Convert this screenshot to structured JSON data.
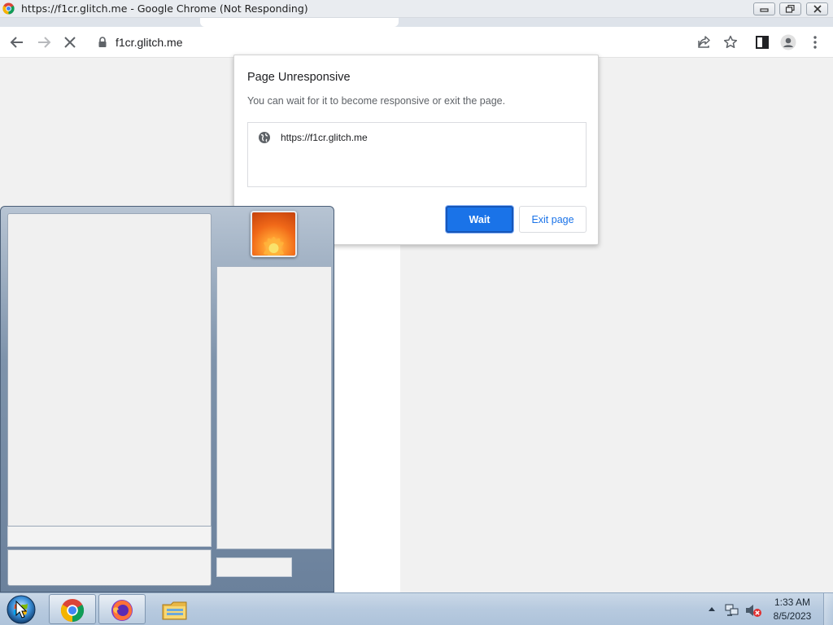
{
  "window": {
    "title": "https://f1cr.glitch.me - Google Chrome (Not Responding)"
  },
  "toolbar": {
    "url": "f1cr.glitch.me"
  },
  "dialog": {
    "title": "Page Unresponsive",
    "message": "You can wait for it to become responsive or exit the page.",
    "pages": [
      {
        "url": "https://f1cr.glitch.me",
        "icon": "globe-icon"
      }
    ],
    "wait_label": "Wait",
    "exit_label": "Exit page"
  },
  "taskbar": {
    "pinned": [
      {
        "name": "chrome",
        "icon": "chrome-icon"
      },
      {
        "name": "firefox",
        "icon": "firefox-icon"
      },
      {
        "name": "explorer",
        "icon": "folder-icon"
      }
    ],
    "clock": {
      "time": "1:33 AM",
      "date": "8/5/2023"
    }
  },
  "colors": {
    "accent": "#1a73e8",
    "taskbar": "#b7cadf",
    "startmenu": "#7e93ab"
  }
}
